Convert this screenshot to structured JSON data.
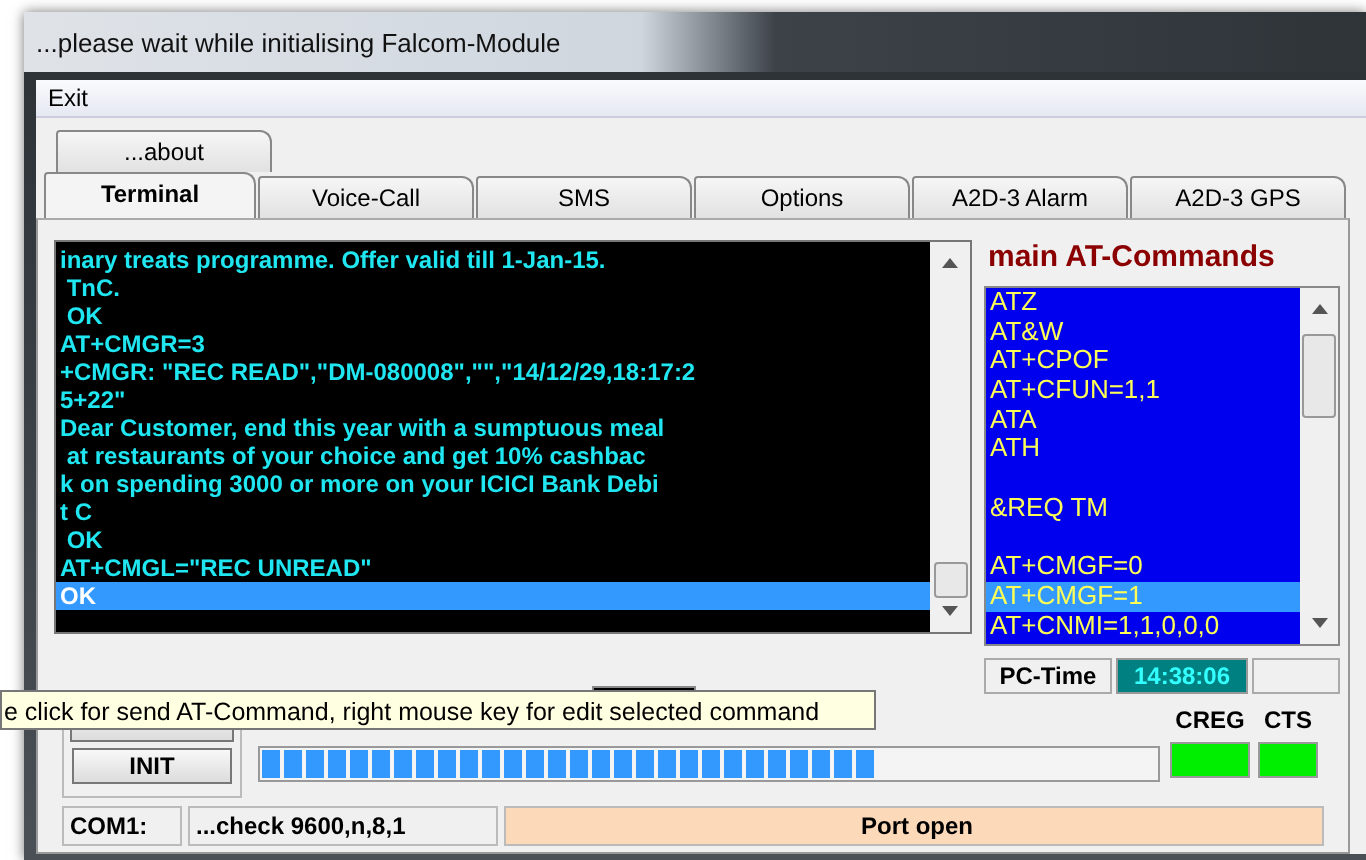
{
  "window": {
    "title": "...please wait while initialising Falcom-Module"
  },
  "menu": [
    "Exit"
  ],
  "tabs_top": [
    {
      "label": "...about",
      "selected": false
    }
  ],
  "tabs": [
    {
      "label": "Terminal",
      "selected": true
    },
    {
      "label": "Voice-Call",
      "selected": false
    },
    {
      "label": "SMS",
      "selected": false
    },
    {
      "label": "Options",
      "selected": false
    },
    {
      "label": "A2D-3 Alarm",
      "selected": false
    },
    {
      "label": "A2D-3 GPS",
      "selected": false
    }
  ],
  "terminal": {
    "lines": [
      {
        "text": "inary treats programme. Offer valid till 1-Jan-15.",
        "selected": false
      },
      {
        "text": " TnC.",
        "selected": false
      },
      {
        "text": " OK",
        "selected": false
      },
      {
        "text": "AT+CMGR=3",
        "selected": false
      },
      {
        "text": "+CMGR: \"REC READ\",\"DM-080008\",\"\",\"14/12/29,18:17:2",
        "selected": false
      },
      {
        "text": "5+22\"",
        "selected": false
      },
      {
        "text": "Dear Customer, end this year with a sumptuous meal",
        "selected": false
      },
      {
        "text": " at restaurants of your choice and get 10% cashbac",
        "selected": false
      },
      {
        "text": "k on spending 3000 or more on your ICICI Bank Debi",
        "selected": false
      },
      {
        "text": "t C",
        "selected": false
      },
      {
        "text": " OK",
        "selected": false
      },
      {
        "text": "AT+CMGL=\"REC UNREAD\"",
        "selected": false
      },
      {
        "text": "OK",
        "selected": true
      }
    ]
  },
  "commands": {
    "title": "main AT-Commands",
    "items": [
      {
        "text": "ATZ",
        "selected": false
      },
      {
        "text": "AT&W",
        "selected": false
      },
      {
        "text": "AT+CPOF",
        "selected": false
      },
      {
        "text": "AT+CFUN=1,1",
        "selected": false
      },
      {
        "text": "ATA",
        "selected": false
      },
      {
        "text": "ATH",
        "selected": false
      },
      {
        "selected": false
      },
      {
        "text": "&REQ TM",
        "selected": false
      },
      {
        "selected": false
      },
      {
        "text": "AT+CMGF=0",
        "selected": false
      },
      {
        "text": "AT+CMGF=1",
        "selected": true
      },
      {
        "text": "AT+CNMI=1,1,0,0,0",
        "selected": false
      }
    ]
  },
  "pc_time": {
    "label": "PC-Time",
    "value": "14:38:06"
  },
  "init_button": "INIT",
  "signal": {
    "level": 0.69
  },
  "indicators": [
    {
      "label": "CREG",
      "on": true
    },
    {
      "label": "CTS",
      "on": true
    }
  ],
  "tooltip": "e click for send AT-Command, right mouse key for edit selected command",
  "status_bar": {
    "port": "COM1:",
    "settings": "...check 9600,n,8,1",
    "state": "Port open"
  }
}
